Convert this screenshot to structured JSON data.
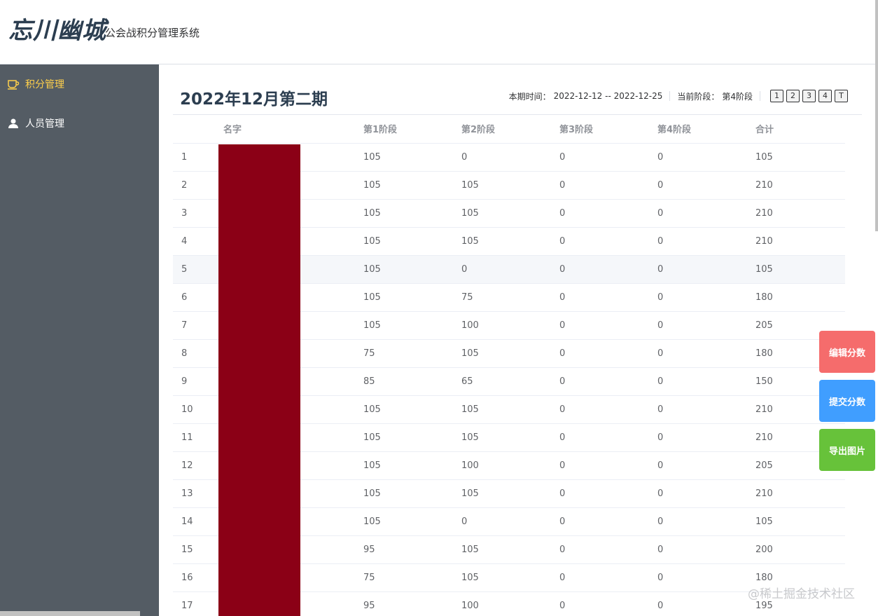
{
  "header": {
    "logo": "忘川幽城",
    "subtitle": "公会战积分管理系统"
  },
  "sidebar": {
    "items": [
      {
        "label": "积分管理",
        "icon": "cup-icon",
        "active": true
      },
      {
        "label": "人员管理",
        "icon": "user-icon",
        "active": false
      }
    ]
  },
  "main": {
    "title": "2022年12月第二期",
    "period_label": "本期时间：",
    "period_value": "2022-12-12 -- 2022-12-25",
    "stage_label": "当前阶段：",
    "stage_value": "第4阶段",
    "stage_buttons": [
      "1",
      "2",
      "3",
      "4",
      "T"
    ]
  },
  "table": {
    "columns": [
      "",
      "名字",
      "第1阶段",
      "第2阶段",
      "第3阶段",
      "第4阶段",
      "合计"
    ],
    "rows": [
      [
        "1",
        "",
        "105",
        "0",
        "0",
        "0",
        "105"
      ],
      [
        "2",
        "",
        "105",
        "105",
        "0",
        "0",
        "210"
      ],
      [
        "3",
        "",
        "105",
        "105",
        "0",
        "0",
        "210"
      ],
      [
        "4",
        "",
        "105",
        "105",
        "0",
        "0",
        "210"
      ],
      [
        "5",
        "",
        "105",
        "0",
        "0",
        "0",
        "105"
      ],
      [
        "6",
        "",
        "105",
        "75",
        "0",
        "0",
        "180"
      ],
      [
        "7",
        "",
        "105",
        "100",
        "0",
        "0",
        "205"
      ],
      [
        "8",
        "",
        "75",
        "105",
        "0",
        "0",
        "180"
      ],
      [
        "9",
        "",
        "85",
        "65",
        "0",
        "0",
        "150"
      ],
      [
        "10",
        "",
        "105",
        "105",
        "0",
        "0",
        "210"
      ],
      [
        "11",
        "",
        "105",
        "105",
        "0",
        "0",
        "210"
      ],
      [
        "12",
        "",
        "105",
        "100",
        "0",
        "0",
        "205"
      ],
      [
        "13",
        "",
        "105",
        "105",
        "0",
        "0",
        "210"
      ],
      [
        "14",
        "",
        "105",
        "0",
        "0",
        "0",
        "105"
      ],
      [
        "15",
        "",
        "95",
        "105",
        "0",
        "0",
        "200"
      ],
      [
        "16",
        "",
        "75",
        "105",
        "0",
        "0",
        "180"
      ],
      [
        "17",
        "",
        "95",
        "100",
        "0",
        "0",
        "195"
      ]
    ]
  },
  "actions": {
    "edit": "编辑分数",
    "submit": "提交分数",
    "export": "导出图片"
  },
  "watermark": "@稀土掘金技术社区",
  "colors": {
    "sidebar_bg": "#545c64",
    "active_menu": "#ffd04b",
    "edit": "#f56c6c",
    "submit": "#409eff",
    "export": "#67c23a",
    "redaction": "#8b0016"
  }
}
